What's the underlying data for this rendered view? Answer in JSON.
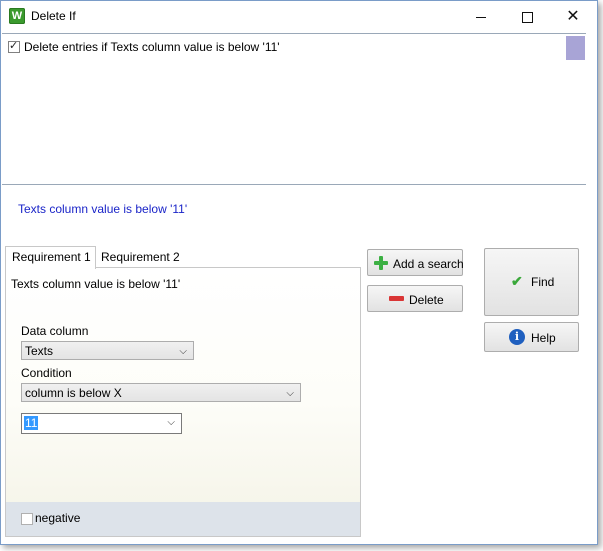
{
  "window": {
    "title": "Delete If",
    "app_icon_letter": "W",
    "minimize_glyph": "",
    "close_glyph": "✕"
  },
  "entries": [
    {
      "label": "Delete entries if Texts column value is below '11'",
      "checked": true
    }
  ],
  "summary_text": "Texts column value is below '11'",
  "tabs": [
    {
      "label": "Requirement 1",
      "active": true
    },
    {
      "label": "Requirement 2",
      "active": false
    }
  ],
  "panel": {
    "description": "Texts column value is below '11'",
    "data_column_label": "Data column",
    "data_column_value": "Texts",
    "condition_label": "Condition",
    "condition_value": "column is below X",
    "value": "11",
    "negative_label": "negative",
    "negative_checked": false
  },
  "buttons": {
    "add_search": "Add a search",
    "delete": "Delete",
    "find": "Find",
    "help": "Help"
  },
  "icons": {
    "add": "plus-icon",
    "delete": "minus-icon",
    "find": "check-icon",
    "help": "info-icon",
    "help_glyph": "i",
    "find_glyph": "✔",
    "chevron_glyph": "⌵"
  },
  "colors": {
    "summary_text": "#1a24c8",
    "scroll_thumb": "#a8a4d6",
    "selection": "#3399ff"
  }
}
